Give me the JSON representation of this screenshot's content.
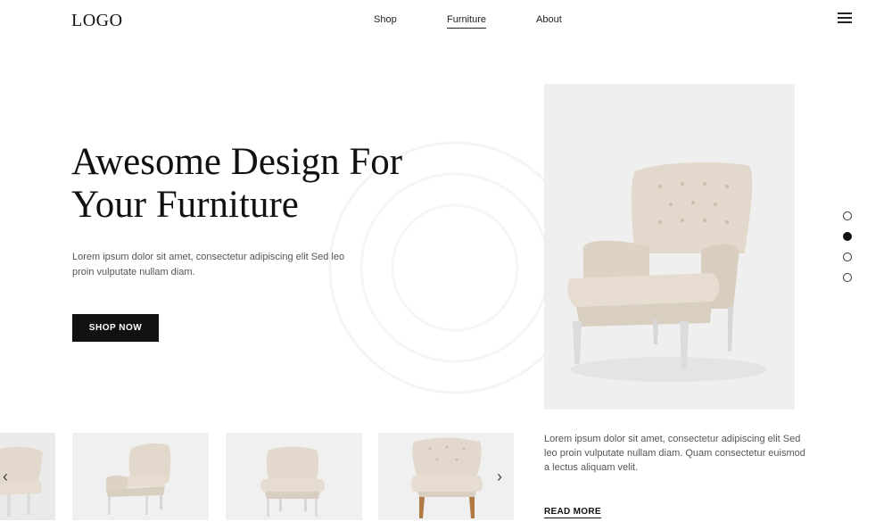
{
  "header": {
    "logo": "LOGO",
    "nav": [
      {
        "label": "Shop",
        "active": false
      },
      {
        "label": "Furniture",
        "active": true
      },
      {
        "label": "About",
        "active": false
      }
    ],
    "menu_icon": "hamburger-icon"
  },
  "hero": {
    "title_line1": "Awesome Design For",
    "title_line2": "Your Furniture",
    "description": "Lorem ipsum dolor sit amet, consectetur adipiscing elit Sed leo proin vulputate nullam diam.",
    "cta_label": "SHOP NOW",
    "image": "armchair-image"
  },
  "slider": {
    "dot_count": 4,
    "active_index": 1
  },
  "thumbnails": {
    "items": [
      "armchair-thumb",
      "armchair-thumb",
      "armchair-thumb",
      "armchair-thumb"
    ],
    "prev_icon": "chevron-left-icon",
    "next_icon": "chevron-right-icon",
    "prev_glyph": "‹",
    "next_glyph": "›"
  },
  "secondary": {
    "description": "Lorem ipsum dolor sit amet, consectetur adipiscing elit Sed leo proin vulputate nullam diam. Quam consectetur euismod a lectus aliquam velit.",
    "link_label": "READ MORE"
  },
  "colors": {
    "text": "#111111",
    "muted": "#555555",
    "image_bg": "#efefef",
    "chair": "#e2d9cc"
  }
}
